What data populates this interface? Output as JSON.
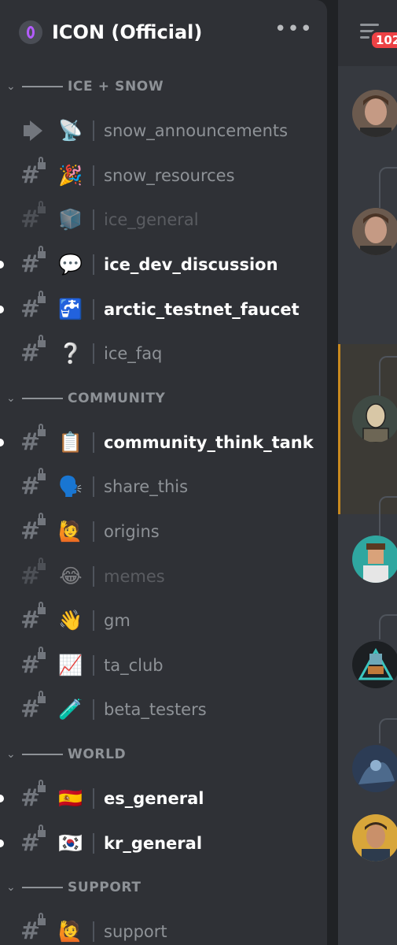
{
  "server": {
    "name": "ICON (Official)",
    "more_label": "•••"
  },
  "categories": [
    {
      "label": "ICE + SNOW",
      "channels": [
        {
          "name": "snow_announcements",
          "emoji": "📡",
          "type": "announcement",
          "state": "normal"
        },
        {
          "name": "snow_resources",
          "emoji": "🎉",
          "type": "text-locked",
          "state": "normal"
        },
        {
          "name": "ice_general",
          "emoji": "🧊",
          "type": "text-locked",
          "state": "muted"
        },
        {
          "name": "ice_dev_discussion",
          "emoji": "💬",
          "type": "text-locked",
          "state": "unread"
        },
        {
          "name": "arctic_testnet_faucet",
          "emoji": "🚰",
          "type": "text-locked",
          "state": "unread"
        },
        {
          "name": "ice_faq",
          "emoji": "❔",
          "type": "text-locked",
          "state": "normal"
        }
      ]
    },
    {
      "label": "COMMUNITY",
      "channels": [
        {
          "name": "community_think_tank",
          "emoji": "📋",
          "type": "text-locked",
          "state": "unread"
        },
        {
          "name": "share_this",
          "emoji": "🗣️",
          "type": "text-locked",
          "state": "normal"
        },
        {
          "name": "origins",
          "emoji": "🙋",
          "type": "text-locked",
          "state": "normal"
        },
        {
          "name": "memes",
          "emoji": "😂",
          "type": "text-locked",
          "state": "muted"
        },
        {
          "name": "gm",
          "emoji": "👋",
          "type": "text-locked",
          "state": "normal"
        },
        {
          "name": "ta_club",
          "emoji": "📈",
          "type": "text-locked",
          "state": "normal"
        },
        {
          "name": "beta_testers",
          "emoji": "🧪",
          "type": "text-locked",
          "state": "normal"
        }
      ]
    },
    {
      "label": "WORLD",
      "channels": [
        {
          "name": "es_general",
          "emoji": "🇪🇸",
          "type": "text-locked",
          "state": "unread"
        },
        {
          "name": "kr_general",
          "emoji": "🇰🇷",
          "type": "text-locked",
          "state": "unread"
        }
      ]
    },
    {
      "label": "SUPPORT",
      "channels": [
        {
          "name": "support",
          "emoji": "🙋",
          "type": "text-locked",
          "state": "normal"
        }
      ]
    }
  ],
  "right_panel": {
    "badge_count": "102"
  },
  "colors": {
    "accent_unread": "#ffffff",
    "muted": "#8e9297",
    "highlight_border": "#c98a1f",
    "badge": "#ed4245"
  }
}
